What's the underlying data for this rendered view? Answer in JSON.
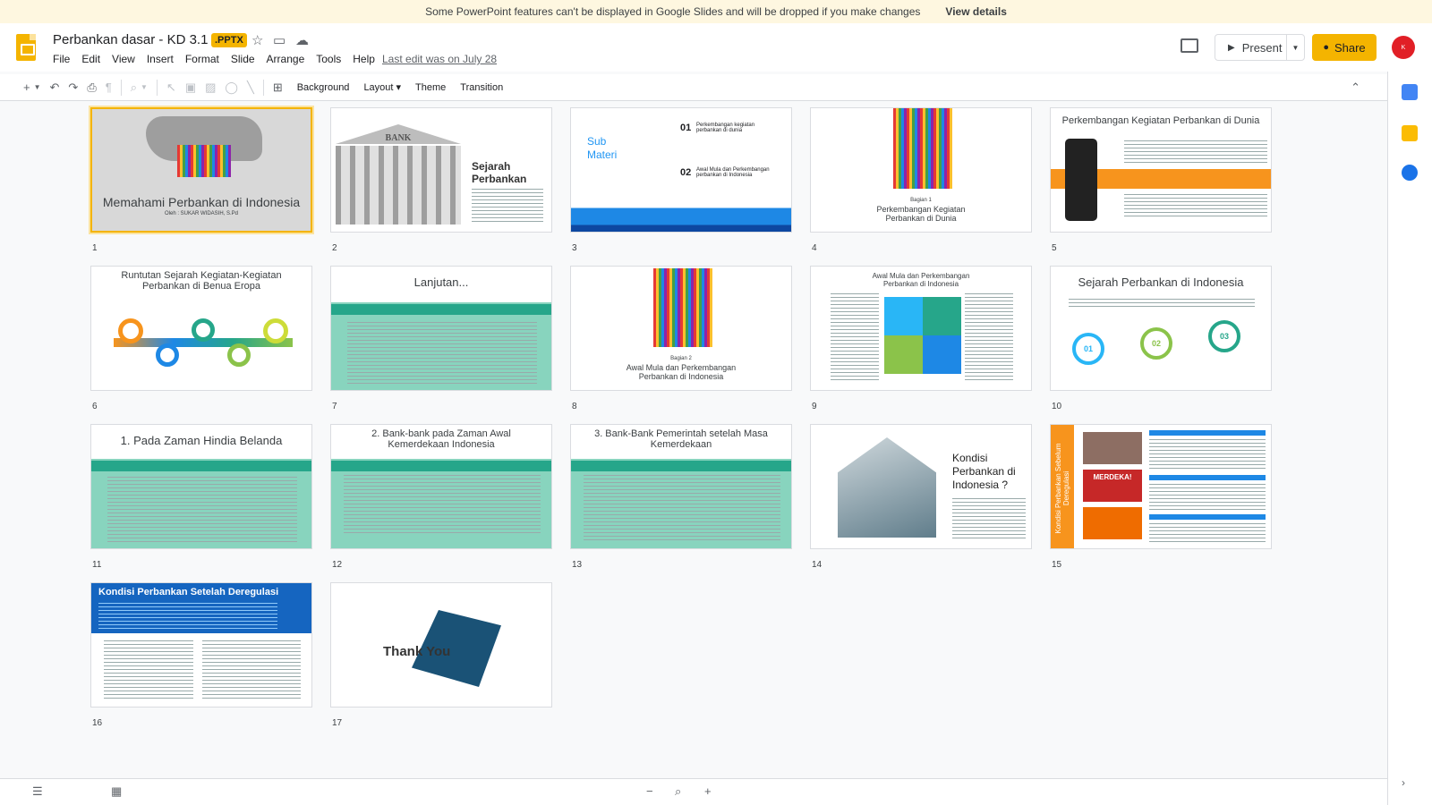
{
  "banner": {
    "message": "Some PowerPoint features can't be displayed in Google Slides and will be dropped if you make changes",
    "link": "View details"
  },
  "doc": {
    "title": "Perbankan dasar - KD 3.1",
    "badge": ".PPTX",
    "last_edit": "Last edit was on July 28"
  },
  "menu": [
    "File",
    "Edit",
    "View",
    "Insert",
    "Format",
    "Slide",
    "Arrange",
    "Tools",
    "Help"
  ],
  "header": {
    "present_label": "Present",
    "share_label": "Share",
    "avatar_text": "K"
  },
  "toolbar": {
    "background": "Background",
    "layout": "Layout",
    "theme": "Theme",
    "transition": "Transition"
  },
  "slides": [
    {
      "num": "1",
      "title": "Memahami Perbankan di Indonesia",
      "sub": "Oleh : SUKAR WIDASIH, S.Pd"
    },
    {
      "num": "2",
      "title": "Sejarah Perbankan",
      "bank_text": "BANK"
    },
    {
      "num": "3",
      "left": "Sub Materi",
      "i1": "01",
      "t1": "Perkembangan kegiatan perbankan di dunia",
      "i2": "02",
      "t2": "Awal Mula dan Perkembangan perbankan di Indonesia"
    },
    {
      "num": "4",
      "part": "Bagian 1",
      "title": "Perkembangan Kegiatan Perbankan di Dunia"
    },
    {
      "num": "5",
      "title": "Perkembangan Kegiatan Perbankan di Dunia"
    },
    {
      "num": "6",
      "title": "Runtutan Sejarah Kegiatan-Kegiatan Perbankan di Benua Eropa"
    },
    {
      "num": "7",
      "title": "Lanjutan..."
    },
    {
      "num": "8",
      "part": "Bagian 2",
      "title": "Awal Mula dan Perkembangan Perbankan di Indonesia"
    },
    {
      "num": "9",
      "title": "Awal Mula dan Perkembangan Perbankan di Indonesia"
    },
    {
      "num": "10",
      "title": "Sejarah Perbankan di Indonesia",
      "c1": "01",
      "c2": "02",
      "c3": "03"
    },
    {
      "num": "11",
      "title": "1. Pada Zaman Hindia Belanda"
    },
    {
      "num": "12",
      "title": "2. Bank-bank pada Zaman Awal Kemerdekaan Indonesia"
    },
    {
      "num": "13",
      "title": "3. Bank-Bank Pemerintah setelah Masa Kemerdekaan"
    },
    {
      "num": "14",
      "title": "Kondisi Perbankan di Indonesia ?"
    },
    {
      "num": "15",
      "side": "Kondisi Perbankan Sebelum Deregulasi",
      "sign": "MERDEKA!"
    },
    {
      "num": "16",
      "title": "Kondisi Perbankan Setelah Deregulasi"
    },
    {
      "num": "17",
      "title": "Thank You"
    }
  ],
  "colors": {
    "accent": "#f4b400",
    "teal": "#26a68a"
  }
}
